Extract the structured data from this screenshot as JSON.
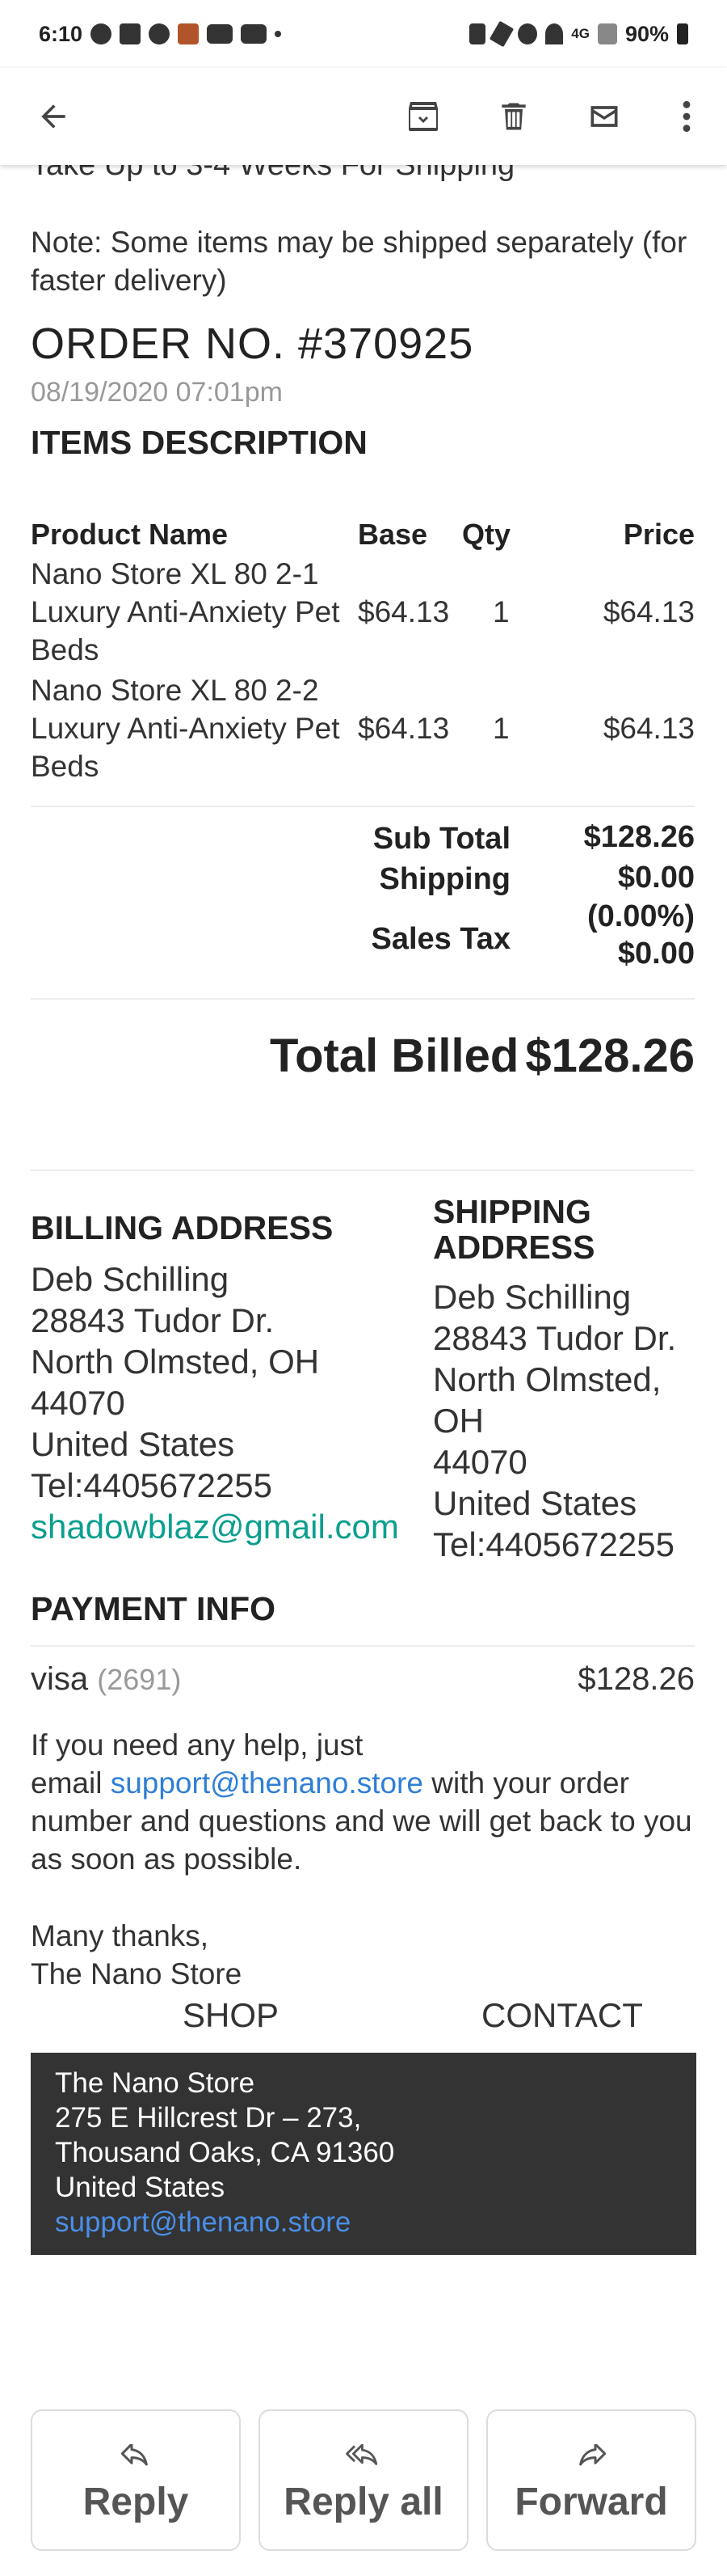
{
  "status_bar": {
    "time": "6:10",
    "battery": "90%",
    "network": "4G"
  },
  "content": {
    "cut_line": "Take Up to 3-4 Weeks For Shipping",
    "note": "Note: Some items may be shipped separately (for faster delivery)",
    "order_no": "ORDER NO.  #370925",
    "order_date": "08/19/2020 07:01pm",
    "items_title": "ITEMS DESCRIPTION",
    "table": {
      "headers": [
        "Product Name",
        "Base",
        "Qty",
        "Price"
      ],
      "rows": [
        {
          "name": "Nano Store XL 80 2-1 Luxury Anti-Anxiety Pet Beds",
          "base": "$64.13",
          "qty": "1",
          "price": "$64.13"
        },
        {
          "name": "Nano Store XL 80 2-2 Luxury Anti-Anxiety Pet Beds",
          "base": "$64.13",
          "qty": "1",
          "price": "$64.13"
        }
      ]
    },
    "totals": {
      "subtotal_label": "Sub Total",
      "subtotal": "$128.26",
      "shipping_label": "Shipping",
      "shipping": "$0.00",
      "tax_label": "Sales Tax",
      "tax_rate": "(0.00%)",
      "tax": "$0.00",
      "total_label": "Total Billed",
      "total": "$128.26"
    },
    "billing": {
      "title": "BILLING ADDRESS",
      "name": "Deb Schilling",
      "street": "28843 Tudor Dr.",
      "city": "North Olmsted, OH",
      "zip": "44070",
      "country": "United States",
      "tel": "Tel:4405672255",
      "email": "shadowblaz@gmail.com"
    },
    "shipping": {
      "title_line1": "SHIPPING",
      "title_line2": "ADDRESS",
      "name": "Deb Schilling",
      "street": "28843 Tudor Dr.",
      "city_line1": "North Olmsted,",
      "city_line2": "OH",
      "zip": "44070",
      "country": "United States",
      "tel": "Tel:4405672255"
    },
    "payment": {
      "title": "PAYMENT INFO",
      "method": "visa",
      "last4": "(2691)",
      "amount": "$128.26"
    },
    "help": {
      "line1": "If you need any help, just",
      "prefix": "email ",
      "email": "support@thenano.store",
      "suffix": " with your order number and questions and we will get back to you as soon as possible."
    },
    "thanks": {
      "line1": "Many thanks,",
      "line2": "The Nano Store"
    },
    "footer_links": {
      "shop": "SHOP",
      "contact": "CONTACT"
    },
    "store": {
      "name": "The Nano Store",
      "street": "275 E Hillcrest Dr – 273,",
      "city": "Thousand Oaks, CA 91360",
      "country": "United States",
      "email": "support@thenano.store"
    }
  },
  "actions": {
    "reply": "Reply",
    "reply_all": "Reply all",
    "forward": "Forward"
  },
  "colors": {
    "link": "#2f7fd6",
    "billing_email": "#0a9f8f",
    "footer_box": "#333333"
  }
}
